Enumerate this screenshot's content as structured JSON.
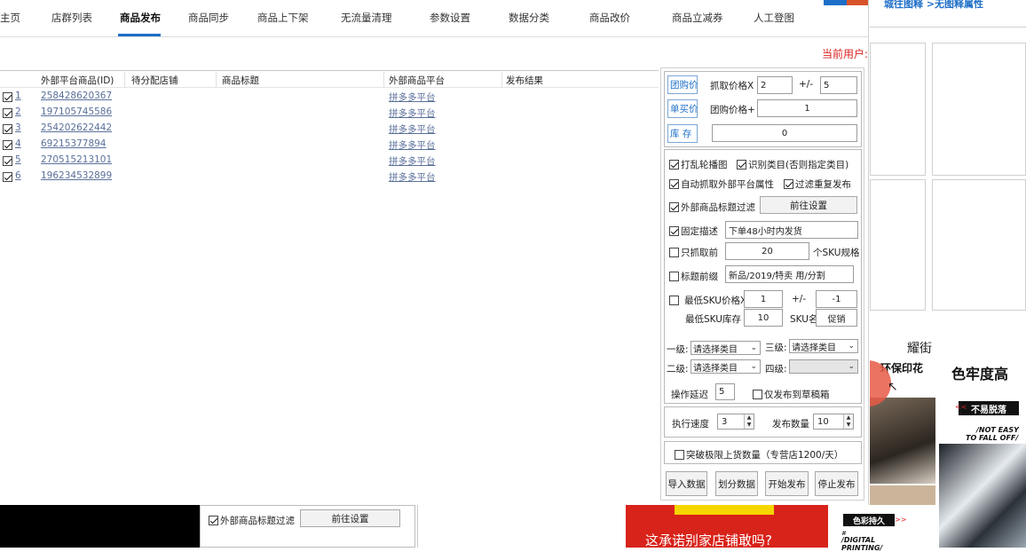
{
  "tabs": [
    {
      "label": "主页"
    },
    {
      "label": "店群列表"
    },
    {
      "label": "商品发布"
    },
    {
      "label": "商品同步"
    },
    {
      "label": "商品上下架"
    },
    {
      "label": "无流量清理"
    },
    {
      "label": "参数设置"
    },
    {
      "label": "数据分类"
    },
    {
      "label": "商品改价"
    },
    {
      "label": "商品立减券"
    },
    {
      "label": "人工登图"
    }
  ],
  "current_user_label": "当前用户:",
  "top_right_text": "城往图释 >无图释属性",
  "table": {
    "headers": [
      "外部平台商品(ID)",
      "待分配店铺",
      "商品标题",
      "外部商品平台",
      "发布结果"
    ],
    "rows": [
      {
        "index": "1",
        "id": "258428620367",
        "platform": "拼多多平台"
      },
      {
        "index": "2",
        "id": "197105745586",
        "platform": "拼多多平台"
      },
      {
        "index": "3",
        "id": "254202622442",
        "platform": "拼多多平台"
      },
      {
        "index": "4",
        "id": "69215377894",
        "platform": "拼多多平台"
      },
      {
        "index": "5",
        "id": "270515213101",
        "platform": "拼多多平台"
      },
      {
        "index": "6",
        "id": "196234532899",
        "platform": "拼多多平台"
      }
    ]
  },
  "price": {
    "group_price_btn": "团购价",
    "fetch_price_label": "抓取价格X",
    "fetch_price_mult": "2",
    "plus_minus": "+/-",
    "fetch_price_delta": "5",
    "single_price_btn": "单买价",
    "group_price_plus_label": "团购价格+",
    "group_price_plus": "1",
    "stock_btn": "库 存",
    "stock_value": "0"
  },
  "options": {
    "shuffle_carousel": "打乱轮播图",
    "identify_category": "识别类目(否则指定类目)",
    "auto_fetch_attrs": "自动抓取外部平台属性",
    "filter_duplicates": "过滤重复发布",
    "title_filter": "外部商品标题过滤",
    "goto_settings": "前往设置",
    "fixed_desc": "固定描述",
    "fixed_desc_value": "下单48小时内发货",
    "only_fetch_first": "只抓取前",
    "only_fetch_count": "20",
    "sku_spec_suffix": "个SKU规格",
    "title_prefix": "标题前缀",
    "title_prefix_value": "新品/2019/特卖 用/分割",
    "min_sku_price": "最低SKU价格X",
    "min_sku_price_mult": "1",
    "min_sku_plus_minus": "+/-",
    "min_sku_price_delta": "-1",
    "min_sku_stock": "最低SKU库存",
    "min_sku_stock_value": "10",
    "sku_name_label": "SKU名",
    "sku_name_value": "促销"
  },
  "category": {
    "level1_label": "一级:",
    "level1_value": "请选择类目",
    "level3_label": "三级:",
    "level3_value": "请选择类目",
    "level2_label": "二级:",
    "level2_value": "请选择类目",
    "level4_label": "四级:",
    "level4_value": ""
  },
  "delay": {
    "label": "操作延迟",
    "value": "5",
    "draft_only": "仅发布到草稿箱"
  },
  "exec": {
    "speed_label": "执行速度",
    "speed_value": "3",
    "count_label": "发布数量",
    "count_value": "10"
  },
  "limit": {
    "label": "突破极限上货数量（专营店1200/天）"
  },
  "actions": {
    "import": "导入数据",
    "split": "划分数据",
    "start": "开始发布",
    "stop": "停止发布"
  },
  "bottom": {
    "title_filter": "外部商品标题过滤",
    "goto_settings": "前往设置",
    "banner_text": "这承诺别家店铺敢吗?"
  },
  "ad": {
    "brand": "耀街",
    "eco_print": "环保印花",
    "colorfast": "色牢度高",
    "no_fade": "不易脱落",
    "not_easy": "/NOT EASY",
    "to_fall_off": "TO FALL OFF/",
    "lasting_color": "色彩持久",
    "digital": "/DIGITAL",
    "printing": "PRINTING/"
  },
  "colors": {
    "accent": "#1e6fc8",
    "link": "#5a6f9a",
    "user_red": "#d22222",
    "banner_red": "#d8231a"
  }
}
